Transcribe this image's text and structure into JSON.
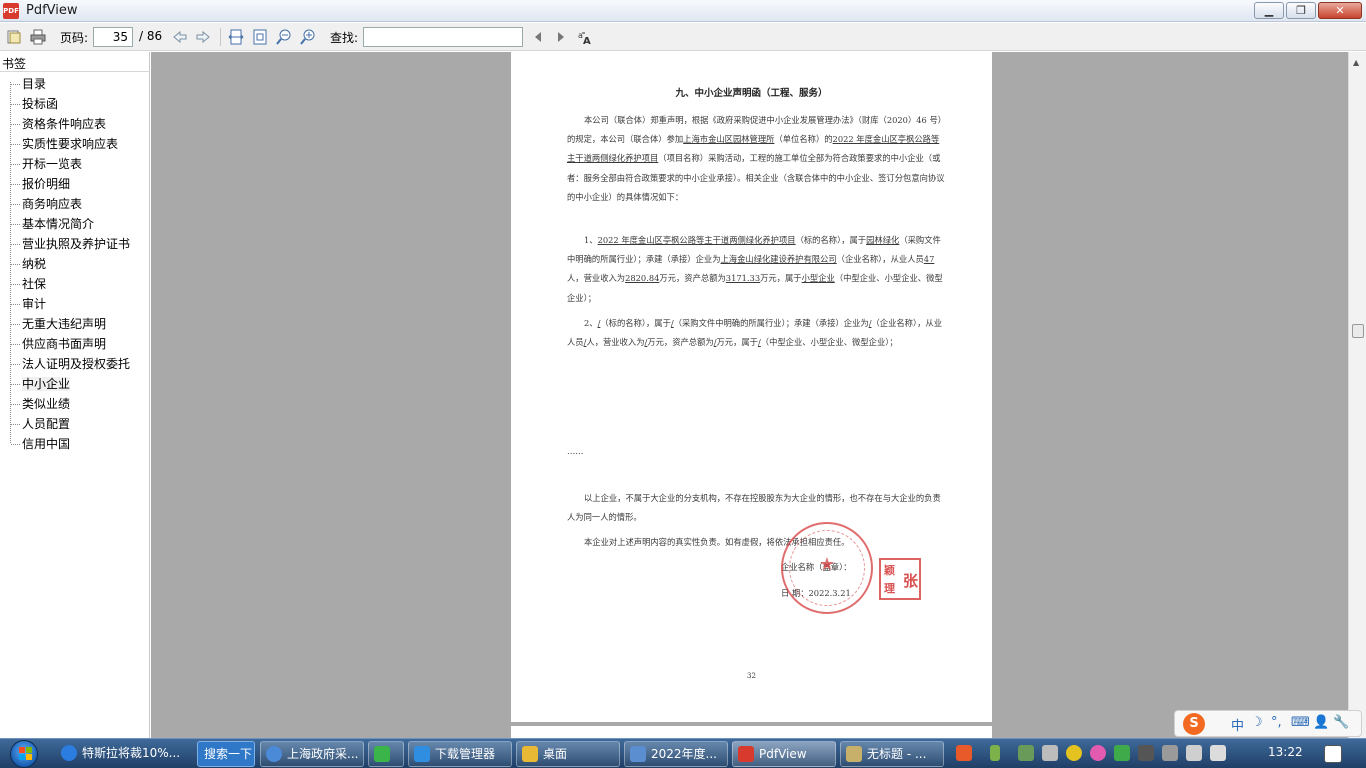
{
  "window": {
    "title": "PdfView",
    "app_icon_text": "PDF"
  },
  "toolbar": {
    "page_label": "页码:",
    "current_page": "35",
    "total_pages": "/ 86",
    "find_label": "查找:",
    "find_value": ""
  },
  "sidebar": {
    "title": "书签",
    "items": [
      {
        "label": "目录"
      },
      {
        "label": "投标函"
      },
      {
        "label": "资格条件响应表"
      },
      {
        "label": "实质性要求响应表"
      },
      {
        "label": "开标一览表"
      },
      {
        "label": "报价明细"
      },
      {
        "label": "商务响应表"
      },
      {
        "label": "基本情况简介"
      },
      {
        "label": "营业执照及养护证书"
      },
      {
        "label": "纳税"
      },
      {
        "label": "社保"
      },
      {
        "label": "审计"
      },
      {
        "label": "无重大违纪声明"
      },
      {
        "label": "供应商书面声明"
      },
      {
        "label": "法人证明及授权委托"
      },
      {
        "label": "中小企业"
      },
      {
        "label": "类似业绩"
      },
      {
        "label": "人员配置"
      },
      {
        "label": "信用中国"
      }
    ],
    "selected": "中小企业"
  },
  "document": {
    "title": "九、中小企业声明函（工程、服务）",
    "p1_a": "本公司（联合体）郑重声明，根据《政府采购促进中小企业发展管理办法》（财库（2020）46 号）的规定，本公司（联合体）参加",
    "p1_u1": "上海市金山区园林管理所",
    "p1_b": "（单位名称）的",
    "p1_u2": "2022 年度金山区亭枫公路等主干道两侧绿化养护项目",
    "p1_c": "（项目名称）采购活动，工程的施工单位全部为符合政策要求的中小企业（或者：服务全部由符合政策要求的中小企业承接）。相关企业（含联合体中的中小企业、签订分包意向协议的中小企业）的具体情况如下：",
    "p2_a": "1、",
    "p2_u1": "2022 年度金山区亭枫公路等主干道两侧绿化养护项目",
    "p2_b": "（标的名称），属于",
    "p2_u2": "园林绿化",
    "p2_c": "（采购文件中明确的所属行业）；承建（承接）企业为",
    "p2_u3": "上海金山绿化建设养护有限公司",
    "p2_d": "（企业名称），从业人员",
    "p2_u4": "47",
    "p2_e": "人，营业收入为",
    "p2_u5": "2820.84",
    "p2_f": "万元，资产总额为",
    "p2_u6": "3171.33",
    "p2_g": "万元，属于",
    "p2_u7": "小型企业",
    "p2_h": "（中型企业、小型企业、微型企业）；",
    "p3_a": "2、",
    "p3_u1": "/",
    "p3_b": "（标的名称），属于",
    "p3_u2": "/",
    "p3_c": "（采购文件中明确的所属行业）；承建（承接）企业为",
    "p3_u3": "/",
    "p3_d": "（企业名称），从业人员",
    "p3_u4": "/",
    "p3_e": "人，营业收入为",
    "p3_u5": "/",
    "p3_f": "万元，资产总额为",
    "p3_u6": "/",
    "p3_g": "万元，属于",
    "p3_u7": "/",
    "p3_h": "（中型企业、小型企业、微型企业）；",
    "ellipsis": "……",
    "p4": "以上企业，不属于大企业的分支机构，不存在控股股东为大企业的情形，也不存在与大企业的负责人为同一人的情形。",
    "p5": "本企业对上述声明内容的真实性负责。如有虚假，将依法承担相应责任。",
    "sign_name": "企业名称（盖章）：",
    "sign_date": "日 期：2022.3.21",
    "stamp_chars": [
      "颖",
      "张",
      "理"
    ],
    "page_number": "32"
  },
  "ime": {
    "logo": "S",
    "mode": "中",
    "items": [
      "中",
      "☽",
      "°,",
      "⌨",
      "👤",
      "🔧"
    ]
  },
  "taskbar": {
    "tasks": [
      {
        "label": "特斯拉将裁10%...",
        "icon_color": "#2b7de0"
      },
      {
        "label": "搜索一下"
      },
      {
        "label": "上海政府采...",
        "icon_color": "#4a8ad6"
      },
      {
        "label": "",
        "icon_color": "#3bb54a"
      },
      {
        "label": "下载管理器",
        "icon_color": "#2f8ee0"
      },
      {
        "label": "桌面",
        "icon_color": "#e8b935"
      },
      {
        "label": "2022年度...",
        "icon_color": "#5b8dd1"
      },
      {
        "label": "PdfView",
        "icon_color": "#d83a2e"
      },
      {
        "label": "无标题 - ...",
        "icon_color": "#c7b06a"
      }
    ],
    "clock": "13:22"
  }
}
